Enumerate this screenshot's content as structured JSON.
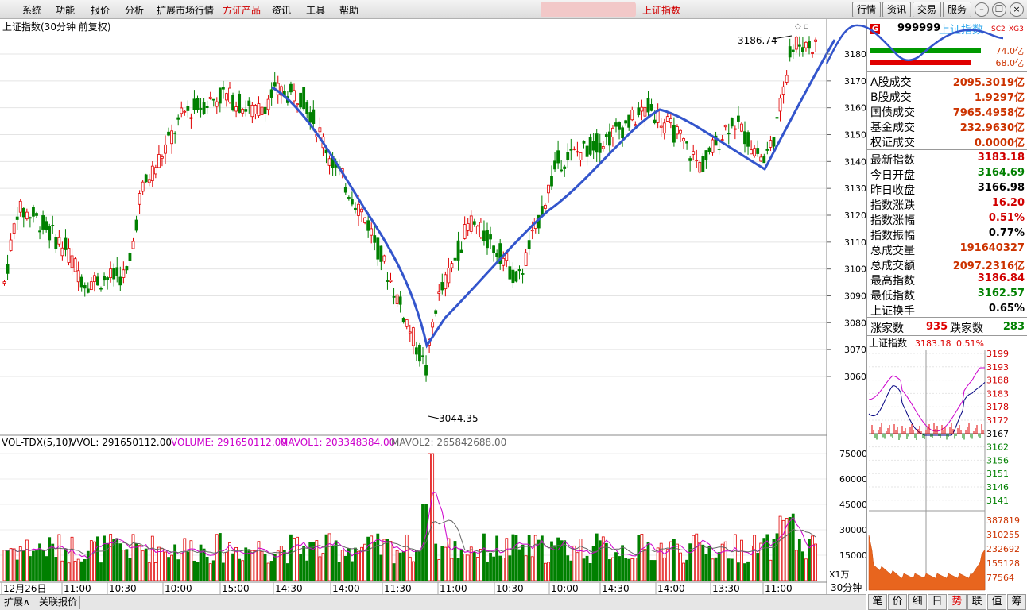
{
  "menu": {
    "items": [
      "系统",
      "功能",
      "报价",
      "分析",
      "扩展市场行情",
      "方证产品",
      "资讯",
      "工具",
      "帮助"
    ],
    "highlighted": "方证产品",
    "center_title": "上证指数",
    "right_buttons": [
      "行情",
      "资讯",
      "交易",
      "服务"
    ]
  },
  "chart_title": "上证指数(30分钟 前复权)",
  "chart_annotations": {
    "high_label": "3186.74",
    "low_label": "3044.35"
  },
  "vol_header": {
    "name": "VOL-TDX(5,10)",
    "vvol": "VVOL: 291650112.00",
    "volume": "VOLUME: 291650112.00",
    "mavol1": "MAVOL1: 203348384.00",
    "mavol2": "MAVOL2: 265842688.00"
  },
  "vol_unit": "X1万",
  "price_axis": [
    "3180",
    "3170",
    "3160",
    "3150",
    "3140",
    "3130",
    "3120",
    "3110",
    "3100",
    "3090",
    "3080",
    "3070",
    "3060"
  ],
  "vol_axis": [
    "75000",
    "60000",
    "45000",
    "30000",
    "15000"
  ],
  "x_axis": [
    "12月26日",
    "11:00",
    "10:30",
    "10:00",
    "15:00",
    "14:30",
    "14:00",
    "11:30",
    "11:00",
    "10:30",
    "10:00",
    "14:30",
    "14:00",
    "13:30",
    "11:00"
  ],
  "period_label": "30分钟",
  "right_panel": {
    "code": "999999",
    "name": "上证指数",
    "tags": [
      "SC2",
      "XG3"
    ],
    "badge": "G",
    "bar1_value": "74.0亿",
    "bar2_value": "68.0亿",
    "turnover": [
      {
        "label": "A股成交",
        "value": "2095.3019亿",
        "color": "#cc3300"
      },
      {
        "label": "B股成交",
        "value": "1.9297亿",
        "color": "#cc3300"
      },
      {
        "label": "国债成交",
        "value": "7965.4958亿",
        "color": "#cc3300"
      },
      {
        "label": "基金成交",
        "value": "232.9630亿",
        "color": "#cc3300"
      },
      {
        "label": "权证成交",
        "value": "0.0000亿",
        "color": "#cc3300"
      }
    ],
    "stats": [
      {
        "label": "最新指数",
        "value": "3183.18",
        "color": "#d00000"
      },
      {
        "label": "今日开盘",
        "value": "3164.69",
        "color": "#008000"
      },
      {
        "label": "昨日收盘",
        "value": "3166.98",
        "color": "#000000"
      },
      {
        "label": "指数涨跌",
        "value": "16.20",
        "color": "#d00000"
      },
      {
        "label": "指数涨幅",
        "value": "0.51%",
        "color": "#d00000"
      },
      {
        "label": "指数振幅",
        "value": "0.77%",
        "color": "#000000"
      },
      {
        "label": "总成交量",
        "value": "191640327",
        "color": "#cc3300"
      },
      {
        "label": "总成交额",
        "value": "2097.2316亿",
        "color": "#cc3300"
      },
      {
        "label": "最高指数",
        "value": "3186.84",
        "color": "#d00000"
      },
      {
        "label": "最低指数",
        "value": "3162.57",
        "color": "#008000"
      },
      {
        "label": "上证换手",
        "value": "0.65%",
        "color": "#000000"
      }
    ],
    "up_label": "涨家数",
    "up_value": "935",
    "down_label": "跌家数",
    "down_value": "283",
    "mini_title": "上证指数",
    "mini_price": "3183.18",
    "mini_pct": "0.51%",
    "mini_price_axis": [
      "3199",
      "3193",
      "3188",
      "3183",
      "3178",
      "3172",
      "3167",
      "3162",
      "3156",
      "3151",
      "3146",
      "3141"
    ],
    "mini_vol_axis": [
      "387819",
      "310255",
      "232692",
      "155128",
      "77564"
    ],
    "tabs": [
      "笔",
      "价",
      "细",
      "日",
      "势",
      "联",
      "值",
      "筹"
    ]
  },
  "bottom_tabs": [
    "扩展∧",
    "关联报价"
  ],
  "colors": {
    "up": "#e00000",
    "down": "#008000",
    "annotation": "#3355cc",
    "ma1": "#cc00cc",
    "ma2": "#666666"
  }
}
